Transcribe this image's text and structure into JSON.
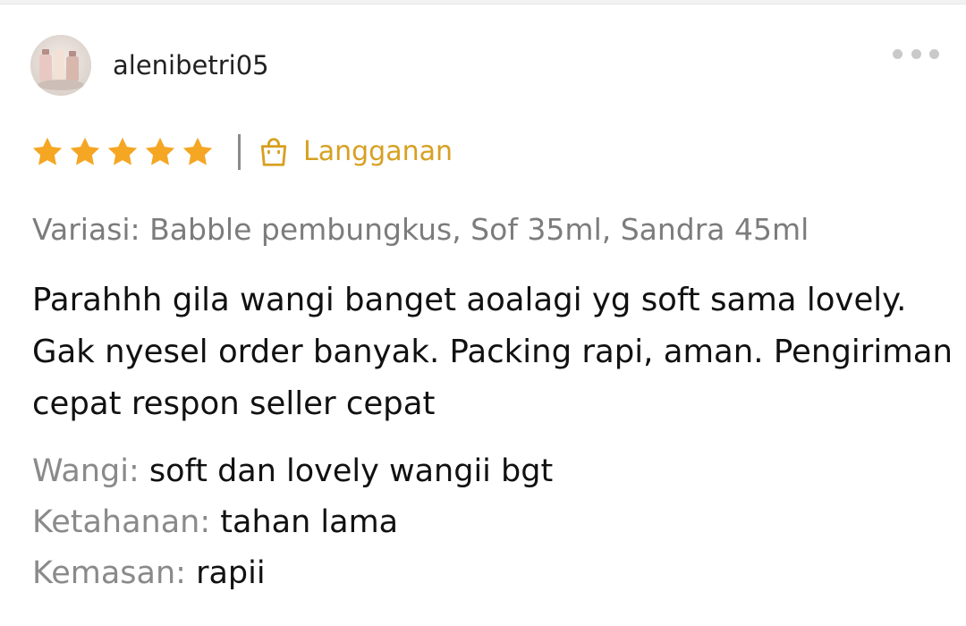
{
  "review": {
    "username": "alenibetri05",
    "rating": 5,
    "max_rating": 5,
    "star_color": "#f5a623",
    "badge": {
      "label": "Langganan",
      "icon": "shopping-bag-icon",
      "color": "#d7a021"
    },
    "variation": "Variasi: Babble pembungkus, Sof 35ml, Sandra 45ml",
    "comment": "Parahhh gila wangi banget aoalagi yg soft sama lovely. Gak nyesel order banyak. Packing rapi, aman. Pengiriman cepat respon seller cepat",
    "attributes": [
      {
        "label": "Wangi:",
        "value": "soft dan lovely wangii bgt"
      },
      {
        "label": "Ketahanan:",
        "value": "tahan lama"
      },
      {
        "label": "Kemasan:",
        "value": "rapii"
      }
    ]
  },
  "icons": {
    "more": "more-horizontal-icon",
    "star": "star-icon",
    "avatar": "avatar-image"
  }
}
